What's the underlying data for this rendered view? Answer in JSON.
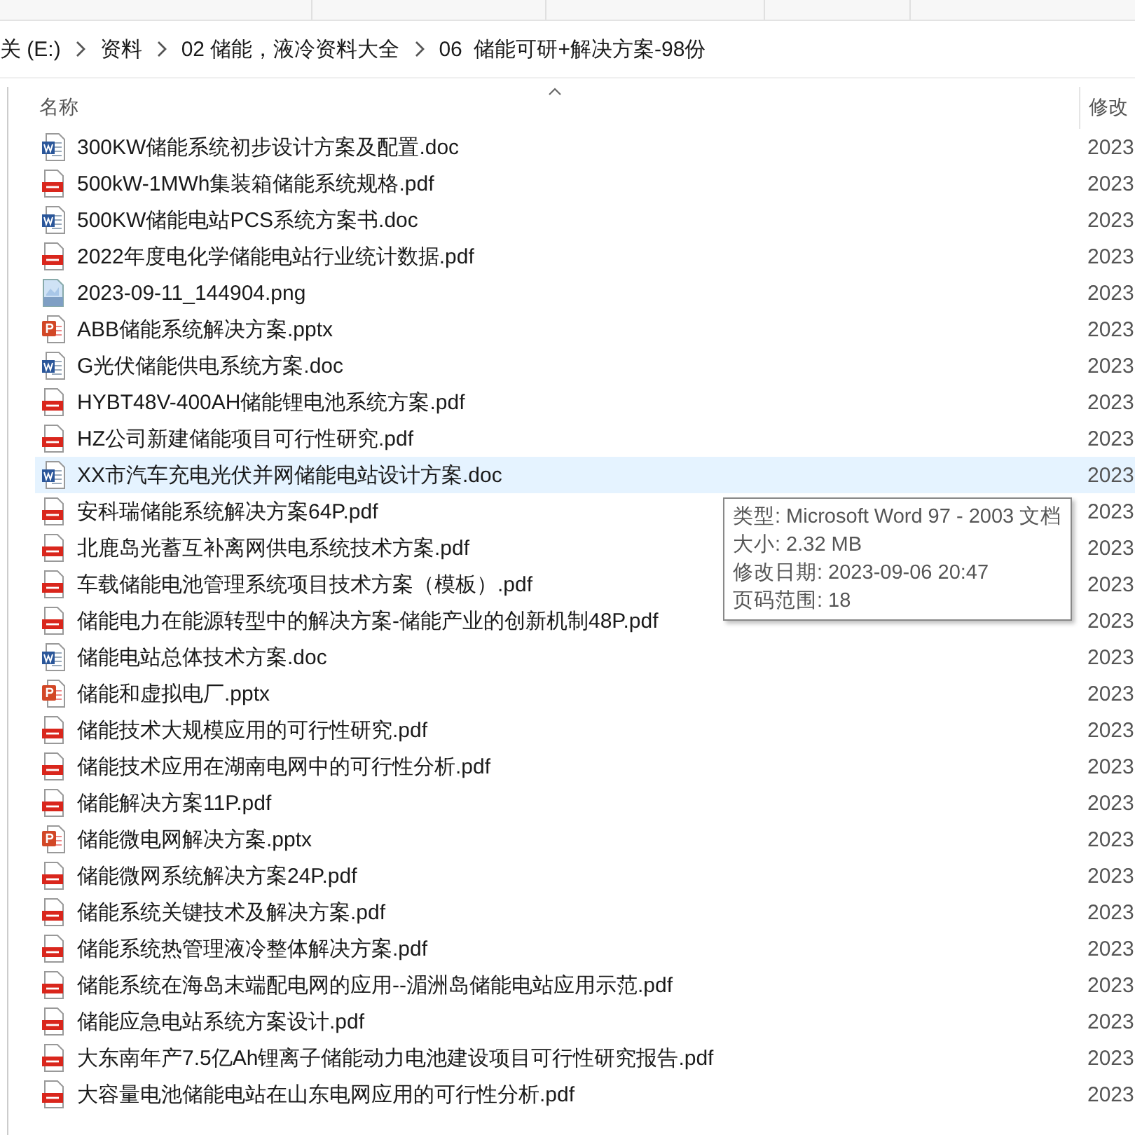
{
  "breadcrumb": [
    "关 (E:)",
    "资料",
    "02 储能，液冷资料大全",
    "06  储能可研+解决方案-98份"
  ],
  "columns": [
    {
      "label": "名称",
      "sorted": true
    },
    {
      "label": "修改",
      "sorted": false
    }
  ],
  "files": [
    {
      "name": "300KW储能系统初步设计方案及配置.doc",
      "kind": "doc",
      "date": "2023",
      "selected": false
    },
    {
      "name": "500kW-1MWh集装箱储能系统规格.pdf",
      "kind": "pdf",
      "date": "2023",
      "selected": false
    },
    {
      "name": "500KW储能电站PCS系统方案书.doc",
      "kind": "doc",
      "date": "2023",
      "selected": false
    },
    {
      "name": "2022年度电化学储能电站行业统计数据.pdf",
      "kind": "pdf",
      "date": "2023",
      "selected": false
    },
    {
      "name": "2023-09-11_144904.png",
      "kind": "png",
      "date": "2023",
      "selected": false
    },
    {
      "name": "ABB储能系统解决方案.pptx",
      "kind": "pptx",
      "date": "2023",
      "selected": false
    },
    {
      "name": "G光伏储能供电系统方案.doc",
      "kind": "doc",
      "date": "2023",
      "selected": false
    },
    {
      "name": "HYBT48V-400AH储能锂电池系统方案.pdf",
      "kind": "pdf",
      "date": "2023",
      "selected": false
    },
    {
      "name": "HZ公司新建储能项目可行性研究.pdf",
      "kind": "pdf",
      "date": "2023",
      "selected": false
    },
    {
      "name": "XX市汽车充电光伏并网储能电站设计方案.doc",
      "kind": "doc",
      "date": "2023",
      "selected": true
    },
    {
      "name": "安科瑞储能系统解决方案64P.pdf",
      "kind": "pdf",
      "date": "2023",
      "selected": false
    },
    {
      "name": "北鹿岛光蓄互补离网供电系统技术方案.pdf",
      "kind": "pdf",
      "date": "2023",
      "selected": false
    },
    {
      "name": "车载储能电池管理系统项目技术方案（模板）.pdf",
      "kind": "pdf",
      "date": "2023",
      "selected": false
    },
    {
      "name": "储能电力在能源转型中的解决方案-储能产业的创新机制48P.pdf",
      "kind": "pdf",
      "date": "2023",
      "selected": false
    },
    {
      "name": "储能电站总体技术方案.doc",
      "kind": "doc",
      "date": "2023",
      "selected": false
    },
    {
      "name": "储能和虚拟电厂.pptx",
      "kind": "pptx",
      "date": "2023",
      "selected": false
    },
    {
      "name": "储能技术大规模应用的可行性研究.pdf",
      "kind": "pdf",
      "date": "2023",
      "selected": false
    },
    {
      "name": "储能技术应用在湖南电网中的可行性分析.pdf",
      "kind": "pdf",
      "date": "2023",
      "selected": false
    },
    {
      "name": "储能解决方案11P.pdf",
      "kind": "pdf",
      "date": "2023",
      "selected": false
    },
    {
      "name": "储能微电网解决方案.pptx",
      "kind": "pptx",
      "date": "2023",
      "selected": false
    },
    {
      "name": "储能微网系统解决方案24P.pdf",
      "kind": "pdf",
      "date": "2023",
      "selected": false
    },
    {
      "name": "储能系统关键技术及解决方案.pdf",
      "kind": "pdf",
      "date": "2023",
      "selected": false
    },
    {
      "name": "储能系统热管理液冷整体解决方案.pdf",
      "kind": "pdf",
      "date": "2023",
      "selected": false
    },
    {
      "name": "储能系统在海岛末端配电网的应用--湄洲岛储能电站应用示范.pdf",
      "kind": "pdf",
      "date": "2023",
      "selected": false
    },
    {
      "name": "储能应急电站系统方案设计.pdf",
      "kind": "pdf",
      "date": "2023",
      "selected": false
    },
    {
      "name": "大东南年产7.5亿Ah锂离子储能动力电池建设项目可行性研究报告.pdf",
      "kind": "pdf",
      "date": "2023",
      "selected": false
    },
    {
      "name": "大容量电池储能电站在山东电网应用的可行性分析.pdf",
      "kind": "pdf",
      "date": "2023",
      "selected": false
    }
  ],
  "tooltip": {
    "lines": [
      "类型: Microsoft Word 97 - 2003 文档",
      "大小: 2.32 MB",
      "修改日期: 2023-09-06 20:47",
      "页码范围: 18"
    ]
  }
}
